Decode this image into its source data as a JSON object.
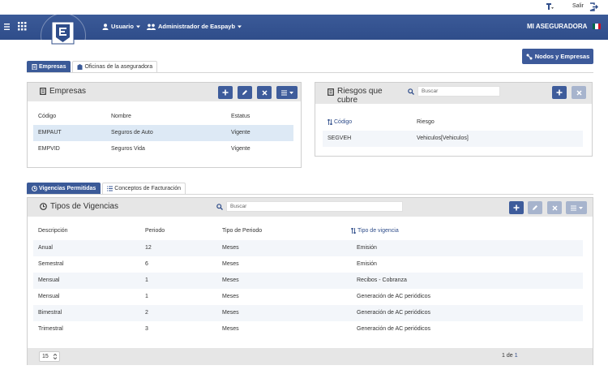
{
  "topbar": {
    "salir_label": "Salir"
  },
  "navbar": {
    "usuario_label": "Usuario",
    "admin_label": "Administrador de Easpayb",
    "brand": "MI ASEGURADORA",
    "flag_colors": [
      "#006847",
      "#ffffff",
      "#ce1126"
    ]
  },
  "nodos_button": "Nodos y Empresas",
  "top_tabs": [
    "Empresas",
    "Oficinas de la aseguradora"
  ],
  "empresas": {
    "title": "Empresas",
    "columns": [
      "Código",
      "Nombre",
      "Estatus"
    ],
    "rows": [
      [
        "EMPAUT",
        "Seguros de Auto",
        "Vigente"
      ],
      [
        "EMPVID",
        "Seguros Vida",
        "Vigente"
      ]
    ]
  },
  "riesgos": {
    "title_line1": "Riesgos que",
    "title_line2": "cubre",
    "search_placeholder": "Buscar",
    "columns": [
      "Código",
      "Riesgo"
    ],
    "rows": [
      [
        "SEGVEH",
        "Vehiculos[Vehiculos]"
      ]
    ]
  },
  "bottom_tabs": [
    "Vigencias Permitidas",
    "Conceptos de Facturación"
  ],
  "vigencias": {
    "title": "Tipos de Vigencias",
    "search_placeholder": "Buscar",
    "columns": [
      "Descripción",
      "Periodo",
      "Tipo de Periodo",
      "Tipo de vigencia"
    ],
    "rows": [
      [
        "Anual",
        "12",
        "Meses",
        "Emisión"
      ],
      [
        "Semestral",
        "6",
        "Meses",
        "Emisión"
      ],
      [
        "Mensual",
        "1",
        "Meses",
        "Recibos - Cobranza"
      ],
      [
        "Mensual",
        "1",
        "Meses",
        "Generación de AC periódicos"
      ],
      [
        "Bimestral",
        "2",
        "Meses",
        "Generación de AC periódicos"
      ],
      [
        "Trimestral",
        "3",
        "Meses",
        "Generación de AC periódicos"
      ]
    ],
    "page_size": "15",
    "page_current": "1",
    "page_of": "de",
    "page_total": "1"
  },
  "colors": {
    "primary": "#3b5a98",
    "selected_row": "#dde9f5",
    "stripe": "#f3f6fa",
    "panel_head": "#e6e6e6"
  }
}
